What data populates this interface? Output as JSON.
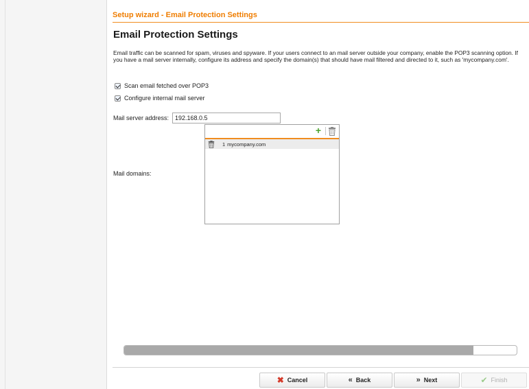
{
  "wizard": {
    "header": "Setup wizard - Email Protection Settings"
  },
  "page": {
    "title": "Email Protection Settings",
    "description": "Email traffic can be scanned for spam, viruses and spyware. If your users connect to an mail server outside your company, enable the POP3 scanning option. If you have a mail server internally, configure its address and specify the domain(s) that should have mail filtered and directed to it, such as 'mycompany.com'."
  },
  "options": {
    "scan_pop3": {
      "label": "Scan email fetched over POP3",
      "checked": true
    },
    "internal_server": {
      "label": "Configure internal mail server",
      "checked": true
    }
  },
  "server": {
    "label": "Mail server address:",
    "value": "192.168.0.5"
  },
  "domains": {
    "label": "Mail domains:",
    "items": [
      {
        "index": "1",
        "name": "mycompany.com"
      }
    ]
  },
  "progress": {
    "fraction": 0.89
  },
  "buttons": {
    "cancel": "Cancel",
    "back": "Back",
    "next": "Next",
    "finish": "Finish"
  },
  "colors": {
    "accent": "#ef7d00",
    "add": "#4aa32e",
    "cancel": "#d43a2a"
  }
}
